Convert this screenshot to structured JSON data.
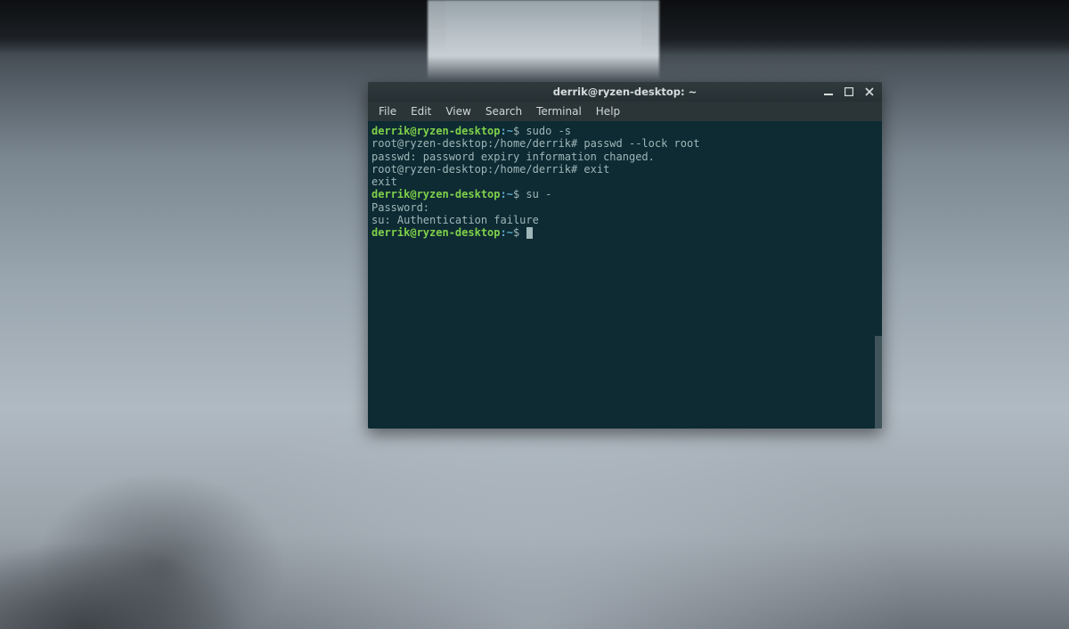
{
  "window": {
    "title": "derrik@ryzen-desktop: ~"
  },
  "menu": {
    "items": [
      "File",
      "Edit",
      "View",
      "Search",
      "Terminal",
      "Help"
    ]
  },
  "prompt": {
    "user_host": "derrik@ryzen-desktop",
    "sep": ":",
    "path": "~",
    "sigil": "$"
  },
  "terminal": {
    "lines": [
      {
        "type": "prompt",
        "cmd": "sudo -s"
      },
      {
        "type": "plain",
        "text": "root@ryzen-desktop:/home/derrik# passwd --lock root"
      },
      {
        "type": "plain",
        "text": "passwd: password expiry information changed."
      },
      {
        "type": "plain",
        "text": "root@ryzen-desktop:/home/derrik# exit"
      },
      {
        "type": "plain",
        "text": "exit"
      },
      {
        "type": "prompt",
        "cmd": "su -"
      },
      {
        "type": "plain",
        "text": "Password:"
      },
      {
        "type": "plain",
        "text": "su: Authentication failure"
      },
      {
        "type": "prompt_cursor",
        "cmd": ""
      }
    ]
  },
  "colors": {
    "terminal_bg": "#0e2a33",
    "user_host": "#7fd14a",
    "path": "#5aa9c7",
    "text": "#9fb7b8",
    "titlebar_bg": "#2a3437"
  }
}
